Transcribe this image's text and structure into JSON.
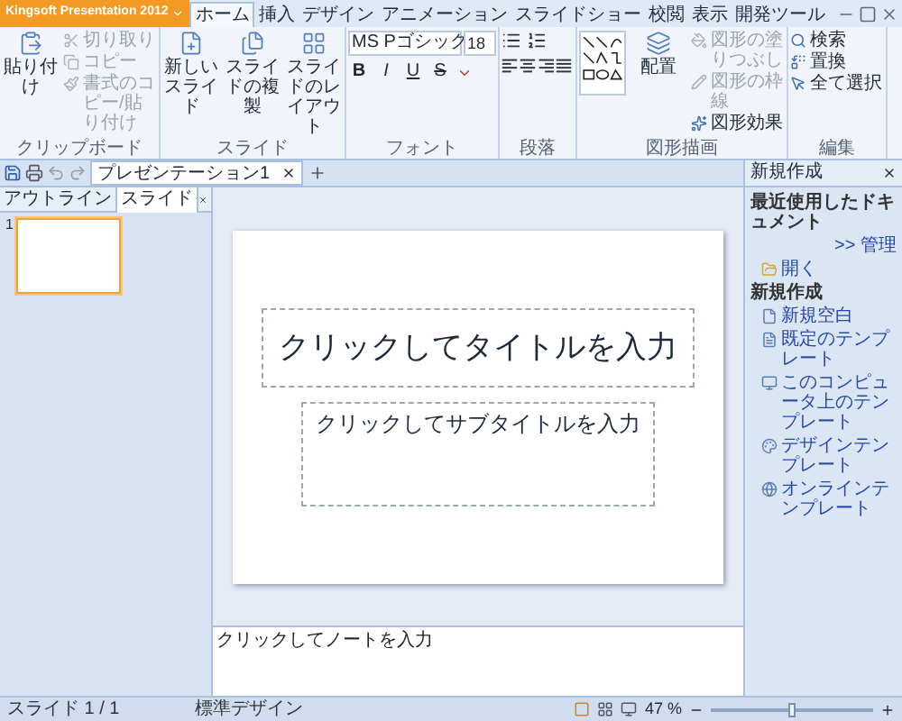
{
  "app_button": {
    "label": "Kingsoft Presentation 2012"
  },
  "ribbon_tabs": [
    {
      "label": "ホーム",
      "selected": true
    },
    {
      "label": "挿入",
      "selected": false
    },
    {
      "label": "デザイン",
      "selected": false
    },
    {
      "label": "アニメーション",
      "selected": false
    },
    {
      "label": "スライドショー",
      "selected": false
    },
    {
      "label": "校閲",
      "selected": false
    },
    {
      "label": "表示",
      "selected": false
    },
    {
      "label": "開発ツール",
      "selected": false
    }
  ],
  "ribbon_groups": [
    {
      "label": "クリップボード",
      "items": [
        {
          "kind": "large",
          "label": "貼り付け"
        },
        {
          "kind": "stack",
          "items": [
            {
              "label": "切り取り",
              "disabled": true
            },
            {
              "label": "コピー",
              "disabled": true
            },
            {
              "label": "書式のコピー/貼り付け",
              "disabled": true
            }
          ]
        }
      ]
    },
    {
      "label": "スライド",
      "items": [
        {
          "kind": "large",
          "label": "新しいスライド"
        },
        {
          "kind": "large",
          "label": "スライドの複製"
        },
        {
          "kind": "large",
          "label": "スライドのレイアウト"
        }
      ]
    },
    {
      "label": "フォント",
      "items": [
        {
          "kind": "font",
          "font": "MS Pゴシック",
          "size": "18",
          "buttons": [
            "B",
            "I",
            "U",
            "S"
          ]
        }
      ]
    },
    {
      "label": "段落",
      "items": [
        {
          "kind": "paragraph"
        }
      ]
    },
    {
      "label": "図形描画",
      "items": [
        {
          "kind": "shapes"
        },
        {
          "kind": "large",
          "label": "配置"
        },
        {
          "kind": "stack",
          "items": [
            {
              "label": "図形の塗りつぶし",
              "disabled": true
            },
            {
              "label": "図形の枠線",
              "disabled": true
            },
            {
              "label": "図形効果",
              "disabled": false
            }
          ]
        }
      ]
    },
    {
      "label": "編集",
      "items": [
        {
          "kind": "stack",
          "items": [
            {
              "label": "検索",
              "disabled": false
            },
            {
              "label": "置換",
              "disabled": false
            },
            {
              "label": "全て選択",
              "disabled": false
            }
          ]
        }
      ]
    }
  ],
  "document_tabs": [
    {
      "label": "プレゼンテーション1",
      "selected": true
    }
  ],
  "side_tabs": [
    {
      "label": "アウトライン",
      "selected": false
    },
    {
      "label": "スライド",
      "selected": true
    }
  ],
  "slides": [
    {
      "number": "1",
      "selected": true
    }
  ],
  "slide": {
    "title_prompt": "クリックしてタイトルを入力",
    "subtitle_prompt": "クリックしてサブタイトルを入力"
  },
  "notes": {
    "placeholder": "クリックしてノートを入力"
  },
  "task_pane": {
    "title": "新規作成",
    "recent_heading": "最近使用したドキュメント",
    "manage_link": ">> 管理",
    "open": "開く",
    "new_heading": "新規作成",
    "new_items": [
      "新規空白",
      "既定のテンプレート",
      "このコンピュータ上のテンプレート",
      "デザインテンプレート",
      "オンラインテンプレート"
    ]
  },
  "status_bar": {
    "slide": "スライド 1 / 1",
    "design": "標準デザイン",
    "zoom": "47 %"
  },
  "zoom_slider": {
    "level": 0.5
  }
}
